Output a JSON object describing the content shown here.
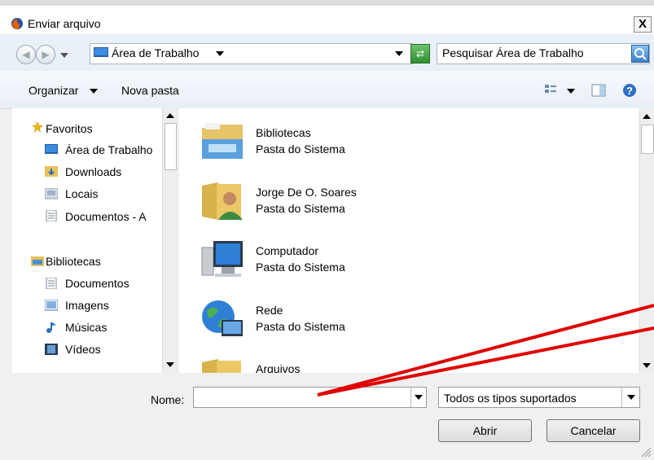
{
  "window": {
    "title": "Enviar arquivo",
    "close_label": "X"
  },
  "address": {
    "path": "Área de Trabalho",
    "search_placeholder": "Pesquisar Área de Trabalho"
  },
  "toolbar": {
    "organize": "Organizar",
    "new_folder": "Nova pasta"
  },
  "sidebar": {
    "favorites_header": "Favoritos",
    "favorites": [
      {
        "label": "Área de Trabalho",
        "icon": "desktop-icon"
      },
      {
        "label": "Downloads",
        "icon": "downloads-icon"
      },
      {
        "label": "Locais",
        "icon": "recent-places-icon"
      },
      {
        "label": "Documentos - A",
        "icon": "documents-icon"
      }
    ],
    "libraries_header": "Bibliotecas",
    "libraries": [
      {
        "label": "Documentos",
        "icon": "documents-icon"
      },
      {
        "label": "Imagens",
        "icon": "pictures-icon"
      },
      {
        "label": "Músicas",
        "icon": "music-icon"
      },
      {
        "label": "Vídeos",
        "icon": "videos-icon"
      }
    ]
  },
  "files": [
    {
      "name": "Bibliotecas",
      "type": "Pasta do Sistema",
      "icon": "libraries-folder-icon"
    },
    {
      "name": "Jorge De O. Soares",
      "type": "Pasta do Sistema",
      "icon": "user-folder-icon"
    },
    {
      "name": "Computador",
      "type": "Pasta do Sistema",
      "icon": "computer-icon"
    },
    {
      "name": "Rede",
      "type": "Pasta do Sistema",
      "icon": "network-icon"
    },
    {
      "name": "Arquivos",
      "type": "",
      "icon": "folder-icon"
    }
  ],
  "footer": {
    "name_label": "Nome:",
    "name_value": "",
    "file_type": "Todos os tipos suportados",
    "open_label": "Abrir",
    "cancel_label": "Cancelar"
  },
  "colors": {
    "annotation_arrow": "#e00000",
    "title_bg": "#ffffff",
    "address_bg": "#eaf0f7"
  }
}
